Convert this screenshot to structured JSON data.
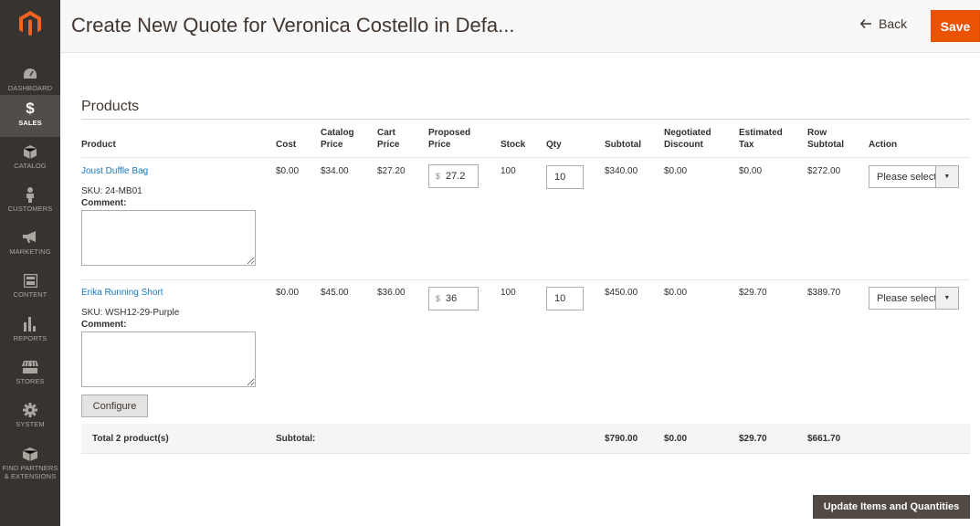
{
  "header": {
    "title": "Create New Quote for Veronica Costello in Defa...",
    "back_label": "Back",
    "save_label": "Save"
  },
  "sidebar": {
    "items": [
      {
        "label": "DASHBOARD",
        "icon": "gauge-icon"
      },
      {
        "label": "SALES",
        "icon": "dollar-icon"
      },
      {
        "label": "CATALOG",
        "icon": "cube-icon"
      },
      {
        "label": "CUSTOMERS",
        "icon": "person-icon"
      },
      {
        "label": "MARKETING",
        "icon": "megaphone-icon"
      },
      {
        "label": "CONTENT",
        "icon": "layout-icon"
      },
      {
        "label": "REPORTS",
        "icon": "bar-chart-icon"
      },
      {
        "label": "STORES",
        "icon": "storefront-icon"
      },
      {
        "label": "SYSTEM",
        "icon": "gear-icon"
      },
      {
        "label": "FIND PARTNERS & EXTENSIONS",
        "icon": "box-icon"
      }
    ]
  },
  "products": {
    "section_title": "Products",
    "columns": {
      "product": "Product",
      "cost": "Cost",
      "catalog_price_1": "Catalog",
      "catalog_price_2": "Price",
      "cart_price_1": "Cart",
      "cart_price_2": "Price",
      "proposed_price_1": "Proposed",
      "proposed_price_2": "Price",
      "stock": "Stock",
      "qty": "Qty",
      "subtotal": "Subtotal",
      "negotiated_1": "Negotiated",
      "negotiated_2": "Discount",
      "tax_1": "Estimated",
      "tax_2": "Tax",
      "row_subtotal_1": "Row",
      "row_subtotal_2": "Subtotal",
      "action": "Action"
    },
    "rows": [
      {
        "name": "Joust Duffle Bag",
        "sku": "SKU: 24-MB01",
        "comment_label": "Comment:",
        "cost": "$0.00",
        "catalog_price": "$34.00",
        "cart_price": "$27.20",
        "currency": "$",
        "proposed_price": "27.2",
        "stock": "100",
        "qty": "10",
        "subtotal": "$340.00",
        "negotiated_discount": "$0.00",
        "estimated_tax": "$0.00",
        "row_subtotal": "$272.00",
        "action": "Please select"
      },
      {
        "name": "Erika Running Short",
        "sku": "SKU: WSH12-29-Purple",
        "comment_label": "Comment:",
        "cost": "$0.00",
        "catalog_price": "$45.00",
        "cart_price": "$36.00",
        "currency": "$",
        "proposed_price": "36",
        "stock": "100",
        "qty": "10",
        "subtotal": "$450.00",
        "negotiated_discount": "$0.00",
        "estimated_tax": "$29.70",
        "row_subtotal": "$389.70",
        "action": "Please select",
        "configure_label": "Configure"
      }
    ],
    "totals": {
      "label": "Total 2 product(s)",
      "subtotal_label": "Subtotal:",
      "subtotal": "$790.00",
      "negotiated_discount": "$0.00",
      "estimated_tax": "$29.70",
      "row_subtotal": "$661.70"
    },
    "update_label": "Update Items and Quantities"
  },
  "colors": {
    "sidebar_bg": "#373330",
    "sidebar_active": "#524d49",
    "accent": "#eb5202",
    "link": "#1979c3",
    "dark_button": "#514943"
  }
}
